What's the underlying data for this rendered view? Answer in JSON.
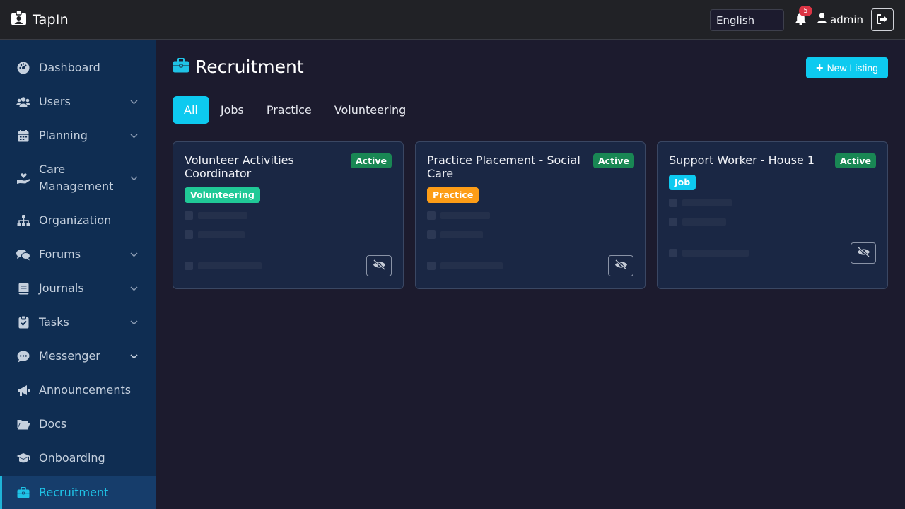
{
  "app": {
    "name": "TapIn"
  },
  "topbar": {
    "language": "English",
    "notification_count": "5",
    "username": "admin"
  },
  "sidebar": {
    "items": [
      {
        "label": "Dashboard",
        "icon": "dashboard-icon"
      },
      {
        "label": "Users",
        "icon": "users-icon"
      },
      {
        "label": "Planning",
        "icon": "calendar-icon"
      },
      {
        "label": "Care Management",
        "icon": "hand-heart-icon"
      },
      {
        "label": "Organization",
        "icon": "sitemap-icon"
      },
      {
        "label": "Forums",
        "icon": "comments-icon"
      },
      {
        "label": "Journals",
        "icon": "book-icon"
      },
      {
        "label": "Tasks",
        "icon": "clipboard-icon"
      },
      {
        "label": "Messenger",
        "icon": "chat-icon"
      },
      {
        "label": "Announcements",
        "icon": "megaphone-icon"
      },
      {
        "label": "Docs",
        "icon": "folder-icon"
      },
      {
        "label": "Onboarding",
        "icon": "graduation-cap-icon"
      },
      {
        "label": "Recruitment",
        "icon": "briefcase-icon"
      }
    ]
  },
  "page": {
    "title": "Recruitment",
    "new_button": "New Listing",
    "tabs": [
      "All",
      "Jobs",
      "Practice",
      "Volunteering"
    ]
  },
  "listings": [
    {
      "title": "Volunteer Activities Coordinator",
      "status": "Active",
      "type": "Volunteering"
    },
    {
      "title": "Practice Placement - Social Care",
      "status": "Active",
      "type": "Practice"
    },
    {
      "title": "Support Worker - House 1",
      "status": "Active",
      "type": "Job"
    }
  ],
  "colors": {
    "accent": "#0dcaf0",
    "active_status": "#198754",
    "volunteering": "#20c997",
    "practice": "#fd9d16",
    "sidebar_bg": "#0f2d52"
  }
}
